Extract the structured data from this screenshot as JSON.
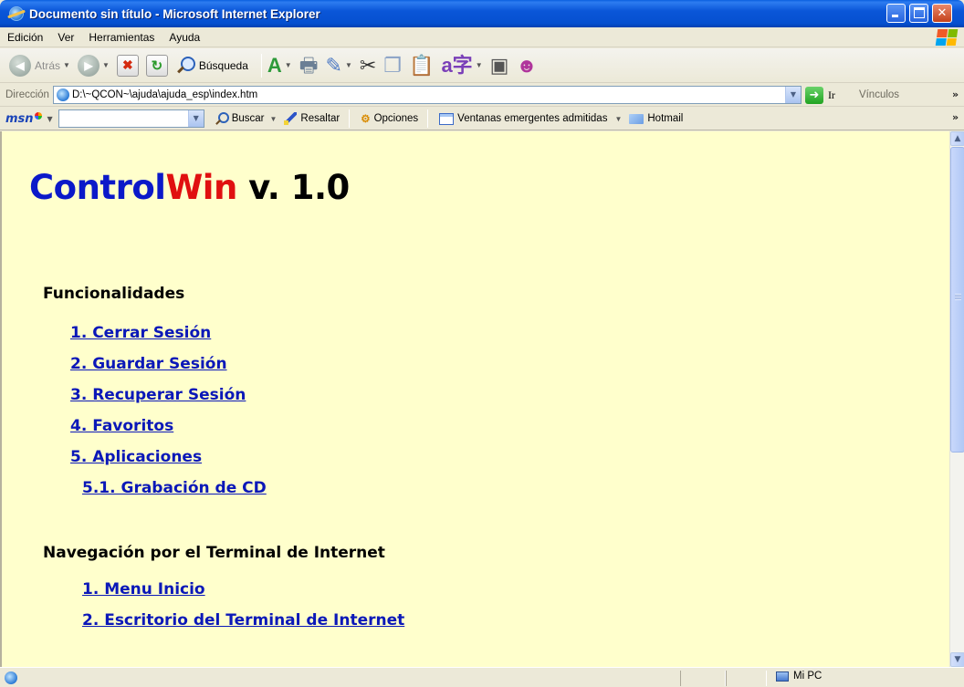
{
  "window": {
    "title": "Documento sin título - Microsoft Internet Explorer"
  },
  "menu": [
    "Edición",
    "Ver",
    "Herramientas",
    "Ayuda"
  ],
  "toolbar": {
    "back_label": "Atrás",
    "search_label": "Búsqueda"
  },
  "address": {
    "label": "Dirección",
    "value": "D:\\~QCON~\\ajuda\\ajuda_esp\\index.htm",
    "go_label": "Ir",
    "links_label": "Vínculos"
  },
  "msn": {
    "logo": "msn",
    "search_value": "",
    "buscar_label": "Buscar",
    "resaltar_label": "Resaltar",
    "opciones_label": "Opciones",
    "popups_label": "Ventanas emergentes admitidas",
    "hotmail_label": "Hotmail"
  },
  "page": {
    "title_control": "Control",
    "title_win": "Win",
    "title_version": " v. 1.0",
    "section1": "Funcionalidades",
    "section1_links": [
      "1. Cerrar Sesión",
      "2. Guardar Sesión",
      "3. Recuperar Sesión",
      "4. Favoritos",
      "5. Aplicaciones",
      "5.1. Grabación de CD"
    ],
    "section2": "Navegación por el Terminal de Internet",
    "section2_links": [
      "1. Menu Inicio",
      "2. Escritorio del Terminal de Internet"
    ]
  },
  "status": {
    "zone_label": "Mi PC"
  },
  "colors": {
    "page_background": "#ffffcc",
    "link": "#0b18b8",
    "title_blue": "#0b19c9",
    "title_red": "#e01010",
    "titlebar_blue": "#0a56d8"
  }
}
